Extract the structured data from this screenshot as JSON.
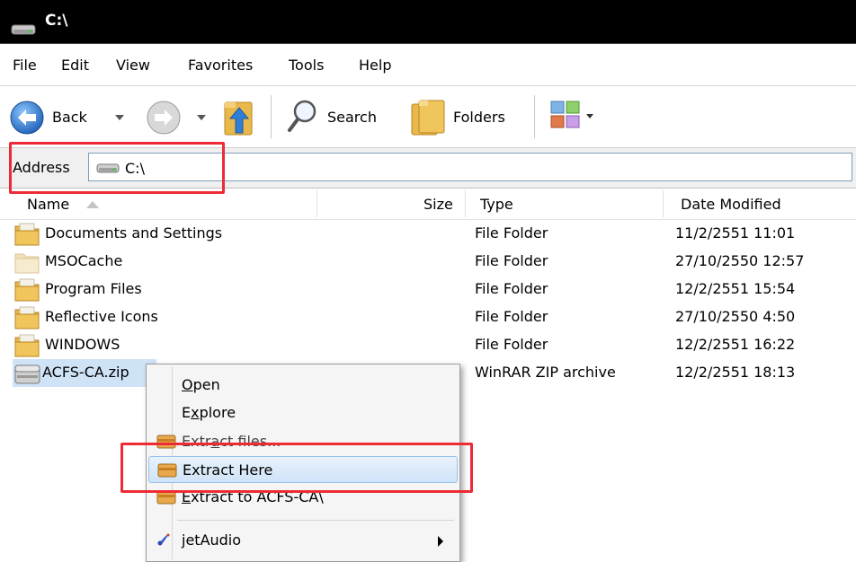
{
  "window": {
    "title": "C:\\"
  },
  "menubar": {
    "items": [
      "File",
      "Edit",
      "View",
      "Favorites",
      "Tools",
      "Help"
    ]
  },
  "toolbar": {
    "back_label": "Back",
    "search_label": "Search",
    "folders_label": "Folders"
  },
  "address": {
    "label": "Address",
    "value": "C:\\"
  },
  "columns": {
    "name": "Name",
    "size": "Size",
    "type": "Type",
    "date": "Date Modified"
  },
  "files": [
    {
      "name": "Documents and Settings",
      "size": "",
      "type": "File Folder",
      "date": "11/2/2551 11:01",
      "icon": "folder-icon"
    },
    {
      "name": "MSOCache",
      "size": "",
      "type": "File Folder",
      "date": "27/10/2550 12:57",
      "icon": "hidden-folder-icon"
    },
    {
      "name": "Program Files",
      "size": "",
      "type": "File Folder",
      "date": "12/2/2551 15:54",
      "icon": "folder-icon"
    },
    {
      "name": "Reflective Icons",
      "size": "",
      "type": "File Folder",
      "date": "27/10/2550 4:50",
      "icon": "folder-icon"
    },
    {
      "name": "WINDOWS",
      "size": "",
      "type": "File Folder",
      "date": "12/2/2551 16:22",
      "icon": "folder-icon"
    },
    {
      "name": "ACFS-CA.zip",
      "size": "",
      "type": "WinRAR ZIP archive",
      "date": "12/2/2551 18:13",
      "icon": "winrar-archive-icon"
    }
  ],
  "context_menu": {
    "open_pre": "",
    "open_key": "O",
    "open_post": "pen",
    "explore_pre": "E",
    "explore_key": "x",
    "explore_post": "plore",
    "extract_files_pre": "Extr",
    "extract_files_key": "a",
    "extract_files_post": "ct files...",
    "extract_here_label": "Extract Here",
    "extract_to_pre": "",
    "extract_to_key": "E",
    "extract_to_post": "xtract to ACFS-CA\\",
    "jetaudio_label": "jetAudio"
  },
  "colors": {
    "highlight": "#ee2b35",
    "selection": "#cfe3f7",
    "folder": "#e8b84a"
  }
}
